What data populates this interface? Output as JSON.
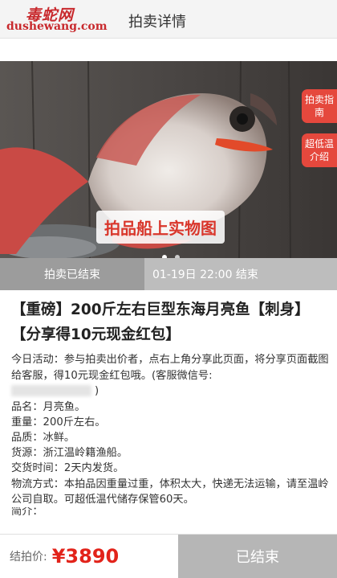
{
  "header": {
    "logo_cn": "毒蛇网",
    "logo_en": "dushewang.com",
    "title": "拍卖详情"
  },
  "banner": {
    "caption": "拍品船上实物图",
    "guide_button": "拍卖指南",
    "lowtemp_button": "超低温介绍",
    "slide_index": "1",
    "slide_count": "2"
  },
  "status": {
    "state": "拍卖已结束",
    "end_time": "01-19日 22:00 结束"
  },
  "item": {
    "title": "【重磅】200斤左右巨型东海月亮鱼【刺身】【分享得10元现金红包】",
    "activity": "今日活动：参与拍卖出价者，点右上角分享此页面，将分享页面截图给客服，得10元现金红包哦。(客服微信号:",
    "activity_tail": ")",
    "details": [
      "品名：月亮鱼。",
      "重量：200斤左右。",
      "品质：冰鲜。",
      "货源：浙江温岭籍渔船。",
      "交货时间：2天内发货。",
      "物流方式：本拍品因重量过重，体积太大，快递无法运输，请至温岭公司自取。可超低温代储存保管60天。",
      "简介："
    ]
  },
  "footer": {
    "price_label": "结拍价:",
    "price_value": "¥3890",
    "action": "已结束"
  },
  "colors": {
    "accent_red": "#e2231a",
    "status_gray": "#9c9c9c"
  }
}
